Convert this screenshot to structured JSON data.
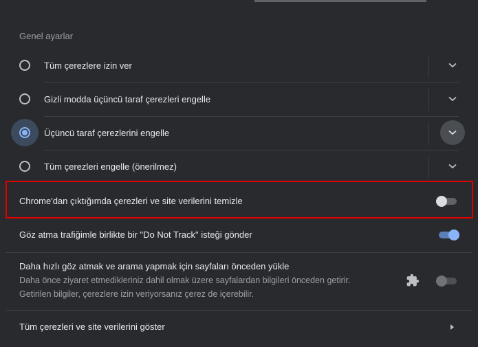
{
  "section": {
    "title": "Genel ayarlar"
  },
  "cookie_options": [
    {
      "label": "Tüm çerezlere izin ver",
      "checked": false
    },
    {
      "label": "Gizli modda üçüncü taraf çerezleri engelle",
      "checked": false
    },
    {
      "label": "Üçüncü taraf çerezlerini engelle",
      "checked": true
    },
    {
      "label": "Tüm çerezleri engelle (önerilmez)",
      "checked": false
    }
  ],
  "settings": {
    "clear_on_exit": {
      "label": "Chrome'dan çıktığımda çerezleri ve site verilerini temizle",
      "enabled": false
    },
    "do_not_track": {
      "label": "Göz atma trafiğimle birlikte bir \"Do Not Track\" isteği gönder",
      "enabled": true
    },
    "preload": {
      "label": "Daha hızlı göz atmak ve arama yapmak için sayfaları önceden yükle",
      "sub_line1": "Daha önce ziyaret etmedikleriniz dahil olmak üzere sayfalardan bilgileri önceden getirir.",
      "sub_line2": "Getirilen bilgiler, çerezlere izin veriyorsanız çerez de içerebilir.",
      "enabled": false,
      "managed_by_extension_icon": "puzzle-icon"
    },
    "show_all": {
      "label": "Tüm çerezleri ve site verilerini göster"
    }
  },
  "colors": {
    "accent": "#8ab4f8",
    "highlight_border": "#e00000",
    "background": "#292a2d"
  }
}
